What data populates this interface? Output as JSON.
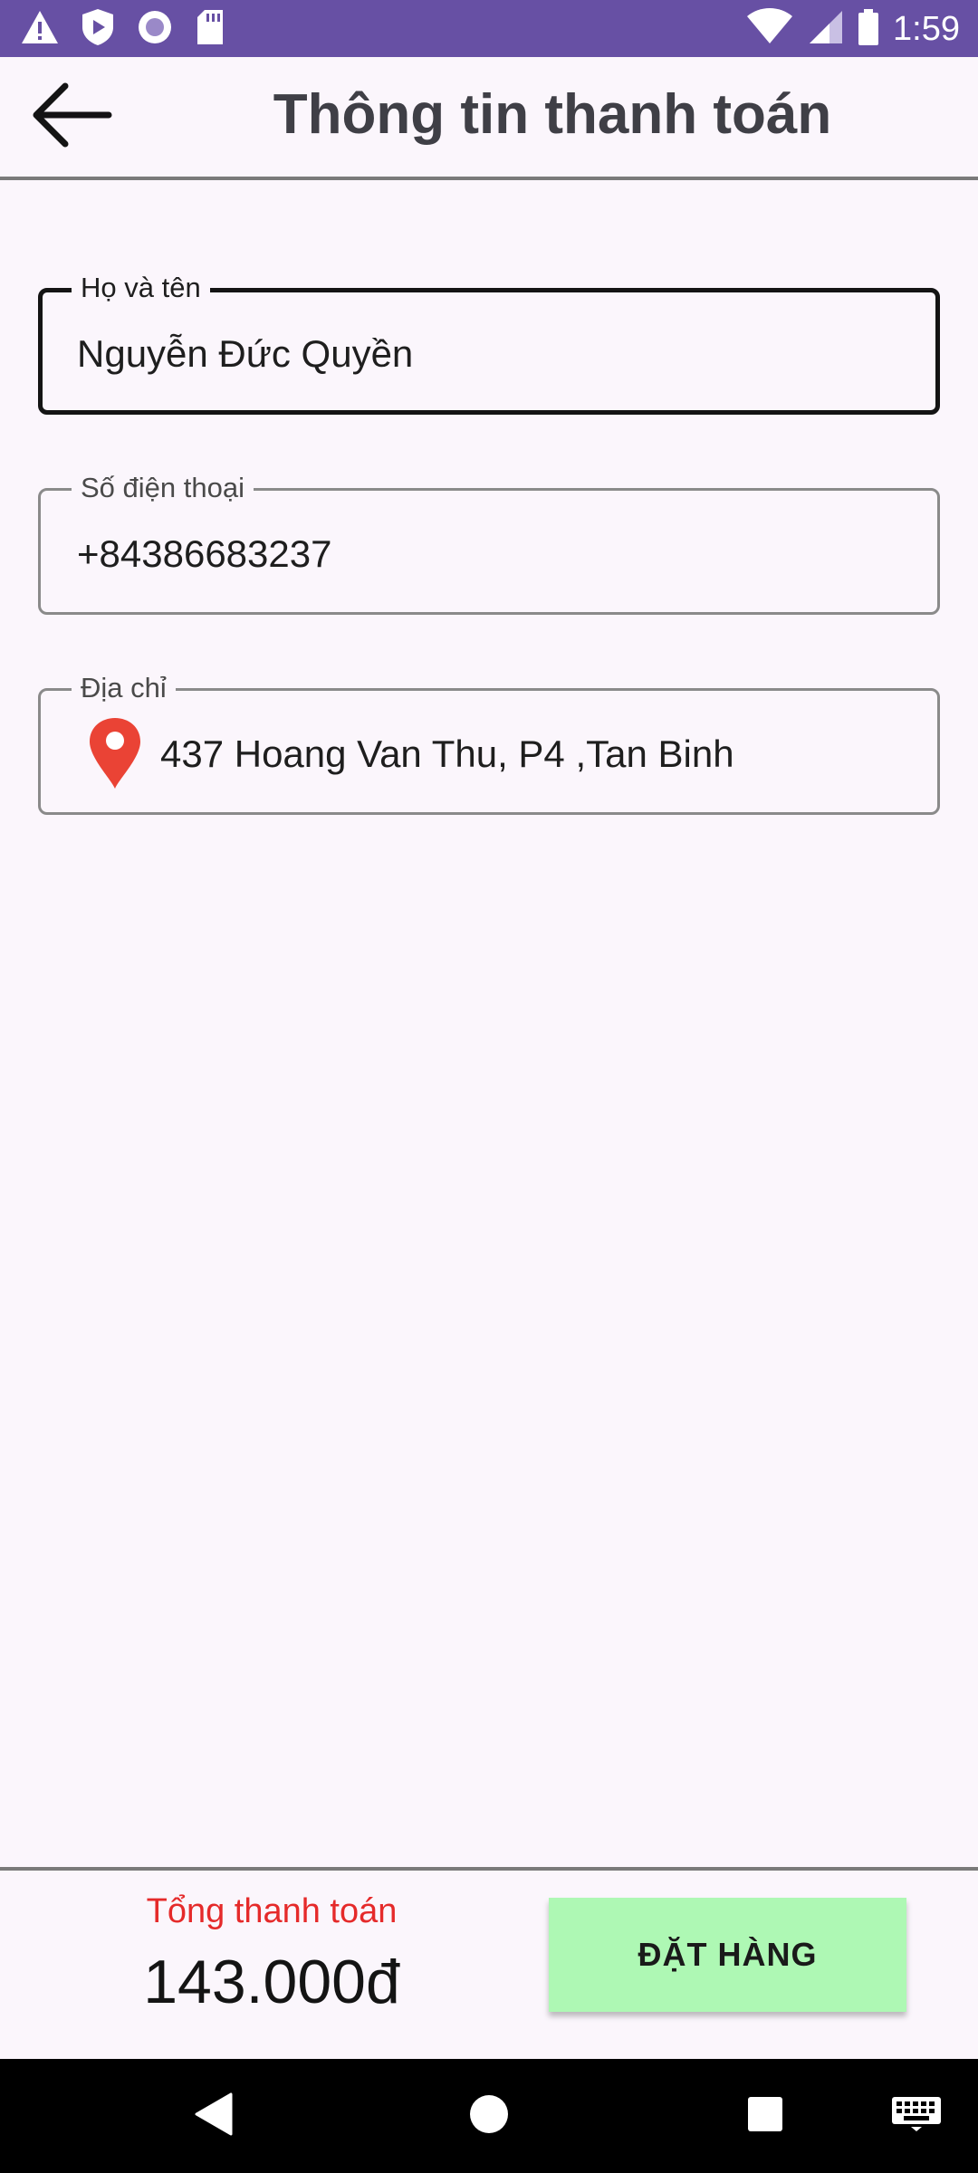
{
  "status_bar": {
    "time": "1:59",
    "left_icons": [
      "warning-icon",
      "shield-play-icon",
      "record-icon",
      "sd-card-icon"
    ],
    "right_icons": [
      "wifi-icon",
      "cell-signal-icon",
      "battery-icon"
    ]
  },
  "app_bar": {
    "title": "Thông tin thanh toán",
    "back_icon": "arrow-left-icon"
  },
  "form": {
    "name": {
      "label": "Họ và tên",
      "value": "Nguyễn Đức Quyền"
    },
    "phone": {
      "label": "Số điện thoại",
      "value": "+84386683237"
    },
    "address": {
      "label": "Địa chỉ",
      "value": "437 Hoang Van Thu, P4 ,Tan Binh",
      "icon": "map-pin-icon"
    }
  },
  "checkout": {
    "total_label": "Tổng thanh toán",
    "total_value": "143.000đ",
    "order_button_label": "ĐẶT HÀNG"
  },
  "nav_bar": {
    "buttons": [
      "back-triangle-icon",
      "home-circle-icon",
      "recents-square-icon",
      "keyboard-icon"
    ]
  },
  "colors": {
    "status_bar": "#6750A4",
    "background": "#FBF6FC",
    "total_label": "#E52A2A",
    "order_button": "#AEF8B4",
    "pin": "#EA4335"
  }
}
